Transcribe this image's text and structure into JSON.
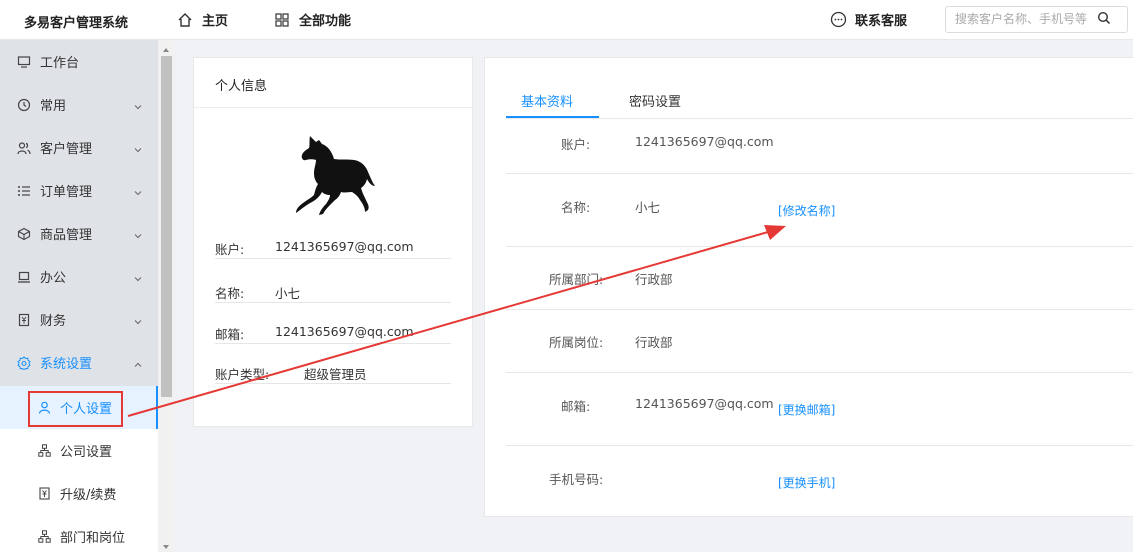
{
  "topbar": {
    "brand": "多易客户管理系统",
    "home_label": "主页",
    "all_label": "全部功能",
    "service_label": "联系客服",
    "search_placeholder": "搜索客户名称、手机号等"
  },
  "sidebar": {
    "items": [
      {
        "label": "工作台",
        "icon": "monitor-icon"
      },
      {
        "label": "常用",
        "icon": "clock-icon"
      },
      {
        "label": "客户管理",
        "icon": "users-icon"
      },
      {
        "label": "订单管理",
        "icon": "list-icon"
      },
      {
        "label": "商品管理",
        "icon": "box-icon"
      },
      {
        "label": "办公",
        "icon": "laptop-icon"
      },
      {
        "label": "财务",
        "icon": "finance-icon"
      },
      {
        "label": "系统设置",
        "icon": "gear-icon"
      }
    ],
    "sub_items": [
      {
        "label": "个人设置",
        "icon": "user-icon"
      },
      {
        "label": "公司设置",
        "icon": "org-icon"
      },
      {
        "label": "升级/续费",
        "icon": "finance-icon"
      },
      {
        "label": "部门和岗位",
        "icon": "org-icon"
      }
    ]
  },
  "profile_card": {
    "title": "个人信息",
    "account_label": "账户:",
    "account_value": "1241365697@qq.com",
    "name_label": "名称:",
    "name_value": "小七",
    "email_label": "邮箱:",
    "email_value": "1241365697@qq.com",
    "type_label": "账户类型:",
    "type_value": "超级管理员"
  },
  "detail_card": {
    "tabs": [
      "基本资料",
      "密码设置"
    ],
    "account_label": "账户:",
    "account_value": "1241365697@qq.com",
    "name_label": "名称:",
    "name_value": "小七",
    "name_link": "[修改名称]",
    "dept_label": "所属部门:",
    "dept_value": "行政部",
    "post_label": "所属岗位:",
    "post_value": "行政部",
    "email_label": "邮箱:",
    "email_value": "1241365697@qq.com",
    "email_link": "[更换邮箱]",
    "phone_label": "手机号码:",
    "phone_link": "[更换手机]"
  },
  "colors": {
    "accent": "#1890ff",
    "annotation": "#e53935"
  }
}
